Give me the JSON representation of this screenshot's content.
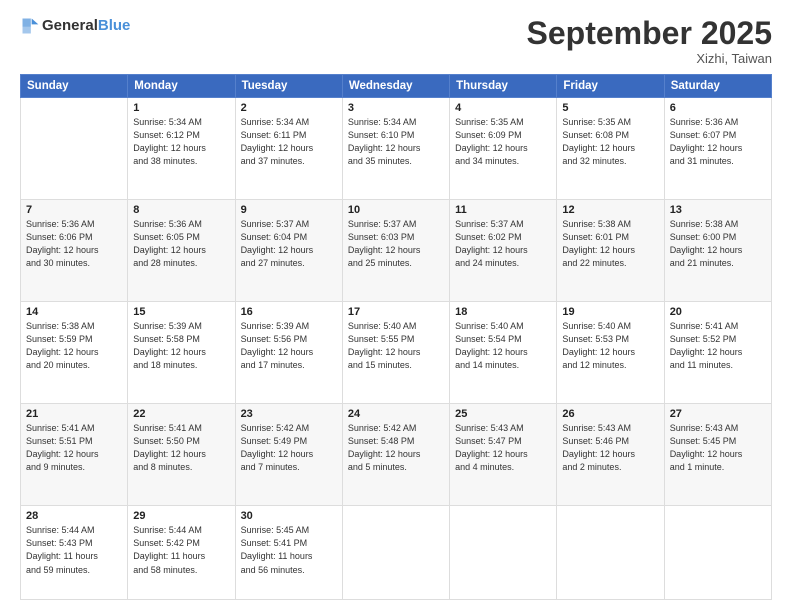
{
  "header": {
    "logo_general": "General",
    "logo_blue": "Blue",
    "month": "September 2025",
    "location": "Xizhi, Taiwan"
  },
  "days_of_week": [
    "Sunday",
    "Monday",
    "Tuesday",
    "Wednesday",
    "Thursday",
    "Friday",
    "Saturday"
  ],
  "weeks": [
    [
      {
        "day": "",
        "info": ""
      },
      {
        "day": "1",
        "info": "Sunrise: 5:34 AM\nSunset: 6:12 PM\nDaylight: 12 hours\nand 38 minutes."
      },
      {
        "day": "2",
        "info": "Sunrise: 5:34 AM\nSunset: 6:11 PM\nDaylight: 12 hours\nand 37 minutes."
      },
      {
        "day": "3",
        "info": "Sunrise: 5:34 AM\nSunset: 6:10 PM\nDaylight: 12 hours\nand 35 minutes."
      },
      {
        "day": "4",
        "info": "Sunrise: 5:35 AM\nSunset: 6:09 PM\nDaylight: 12 hours\nand 34 minutes."
      },
      {
        "day": "5",
        "info": "Sunrise: 5:35 AM\nSunset: 6:08 PM\nDaylight: 12 hours\nand 32 minutes."
      },
      {
        "day": "6",
        "info": "Sunrise: 5:36 AM\nSunset: 6:07 PM\nDaylight: 12 hours\nand 31 minutes."
      }
    ],
    [
      {
        "day": "7",
        "info": "Sunrise: 5:36 AM\nSunset: 6:06 PM\nDaylight: 12 hours\nand 30 minutes."
      },
      {
        "day": "8",
        "info": "Sunrise: 5:36 AM\nSunset: 6:05 PM\nDaylight: 12 hours\nand 28 minutes."
      },
      {
        "day": "9",
        "info": "Sunrise: 5:37 AM\nSunset: 6:04 PM\nDaylight: 12 hours\nand 27 minutes."
      },
      {
        "day": "10",
        "info": "Sunrise: 5:37 AM\nSunset: 6:03 PM\nDaylight: 12 hours\nand 25 minutes."
      },
      {
        "day": "11",
        "info": "Sunrise: 5:37 AM\nSunset: 6:02 PM\nDaylight: 12 hours\nand 24 minutes."
      },
      {
        "day": "12",
        "info": "Sunrise: 5:38 AM\nSunset: 6:01 PM\nDaylight: 12 hours\nand 22 minutes."
      },
      {
        "day": "13",
        "info": "Sunrise: 5:38 AM\nSunset: 6:00 PM\nDaylight: 12 hours\nand 21 minutes."
      }
    ],
    [
      {
        "day": "14",
        "info": "Sunrise: 5:38 AM\nSunset: 5:59 PM\nDaylight: 12 hours\nand 20 minutes."
      },
      {
        "day": "15",
        "info": "Sunrise: 5:39 AM\nSunset: 5:58 PM\nDaylight: 12 hours\nand 18 minutes."
      },
      {
        "day": "16",
        "info": "Sunrise: 5:39 AM\nSunset: 5:56 PM\nDaylight: 12 hours\nand 17 minutes."
      },
      {
        "day": "17",
        "info": "Sunrise: 5:40 AM\nSunset: 5:55 PM\nDaylight: 12 hours\nand 15 minutes."
      },
      {
        "day": "18",
        "info": "Sunrise: 5:40 AM\nSunset: 5:54 PM\nDaylight: 12 hours\nand 14 minutes."
      },
      {
        "day": "19",
        "info": "Sunrise: 5:40 AM\nSunset: 5:53 PM\nDaylight: 12 hours\nand 12 minutes."
      },
      {
        "day": "20",
        "info": "Sunrise: 5:41 AM\nSunset: 5:52 PM\nDaylight: 12 hours\nand 11 minutes."
      }
    ],
    [
      {
        "day": "21",
        "info": "Sunrise: 5:41 AM\nSunset: 5:51 PM\nDaylight: 12 hours\nand 9 minutes."
      },
      {
        "day": "22",
        "info": "Sunrise: 5:41 AM\nSunset: 5:50 PM\nDaylight: 12 hours\nand 8 minutes."
      },
      {
        "day": "23",
        "info": "Sunrise: 5:42 AM\nSunset: 5:49 PM\nDaylight: 12 hours\nand 7 minutes."
      },
      {
        "day": "24",
        "info": "Sunrise: 5:42 AM\nSunset: 5:48 PM\nDaylight: 12 hours\nand 5 minutes."
      },
      {
        "day": "25",
        "info": "Sunrise: 5:43 AM\nSunset: 5:47 PM\nDaylight: 12 hours\nand 4 minutes."
      },
      {
        "day": "26",
        "info": "Sunrise: 5:43 AM\nSunset: 5:46 PM\nDaylight: 12 hours\nand 2 minutes."
      },
      {
        "day": "27",
        "info": "Sunrise: 5:43 AM\nSunset: 5:45 PM\nDaylight: 12 hours\nand 1 minute."
      }
    ],
    [
      {
        "day": "28",
        "info": "Sunrise: 5:44 AM\nSunset: 5:43 PM\nDaylight: 11 hours\nand 59 minutes."
      },
      {
        "day": "29",
        "info": "Sunrise: 5:44 AM\nSunset: 5:42 PM\nDaylight: 11 hours\nand 58 minutes."
      },
      {
        "day": "30",
        "info": "Sunrise: 5:45 AM\nSunset: 5:41 PM\nDaylight: 11 hours\nand 56 minutes."
      },
      {
        "day": "",
        "info": ""
      },
      {
        "day": "",
        "info": ""
      },
      {
        "day": "",
        "info": ""
      },
      {
        "day": "",
        "info": ""
      }
    ]
  ]
}
